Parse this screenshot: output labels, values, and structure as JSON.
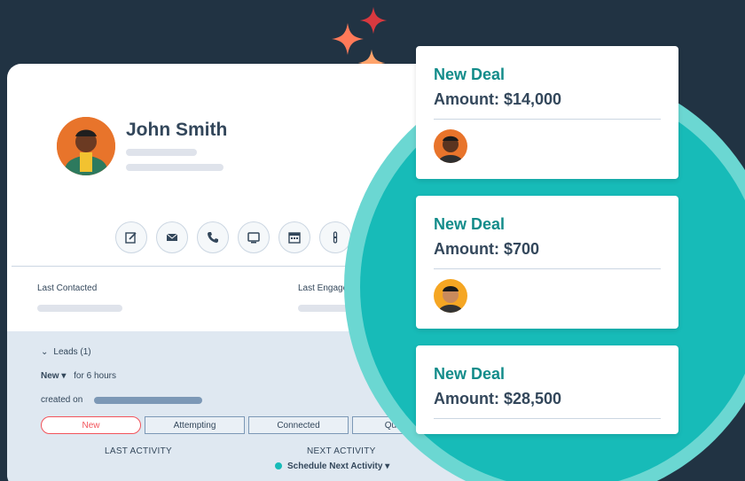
{
  "contact": {
    "name": "John Smith",
    "last_contacted_label": "Last Contacted",
    "last_engaged_label": "Last Engage"
  },
  "actions": [
    {
      "icon": "note-icon"
    },
    {
      "icon": "email-icon"
    },
    {
      "icon": "phone-icon"
    },
    {
      "icon": "meeting-icon"
    },
    {
      "icon": "calendar-icon"
    },
    {
      "icon": "more-icon"
    }
  ],
  "leads": {
    "header": "Leads (1)",
    "status": "New",
    "duration": "for 6 hours",
    "created_label": "created on",
    "stages": [
      "New",
      "Attempting",
      "Connected",
      "Qualified"
    ],
    "last_activity_label": "LAST ACTIVITY",
    "next_activity_label": "NEXT ACTIVITY",
    "next_activity_value": "Schedule Next Activity"
  },
  "deals": [
    {
      "title": "New Deal",
      "amount": "Amount: $14,000"
    },
    {
      "title": "New Deal",
      "amount": "Amount: $700"
    },
    {
      "title": "New Deal",
      "amount": "Amount: $28,500"
    }
  ],
  "colors": {
    "background": "#213343",
    "teal": "#17bbb8",
    "accent_red": "#f2545b",
    "sparkle_orange": "#ff7a59"
  }
}
